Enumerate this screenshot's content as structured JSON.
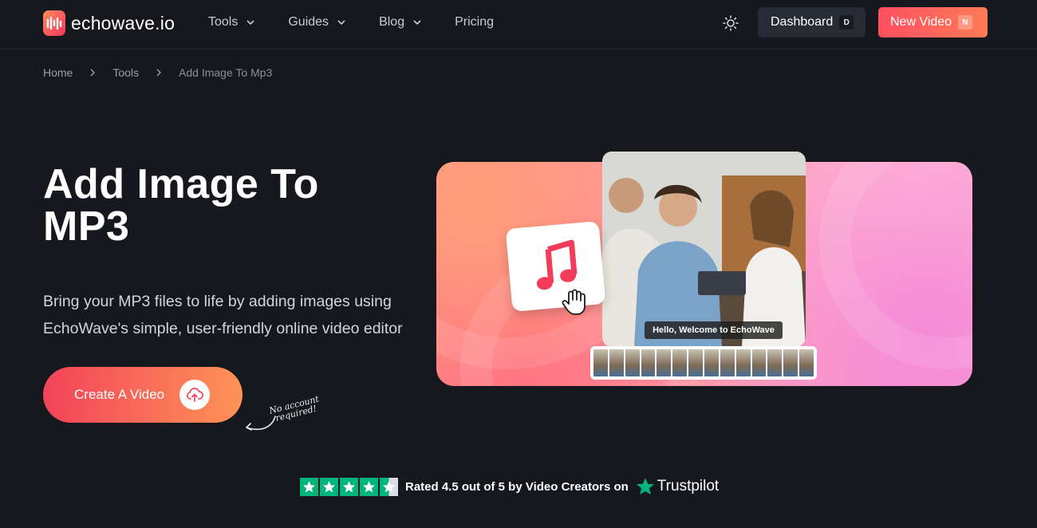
{
  "header": {
    "logo_text": "echowave.io",
    "nav": [
      {
        "label": "Tools",
        "has_dropdown": true
      },
      {
        "label": "Guides",
        "has_dropdown": true
      },
      {
        "label": "Blog",
        "has_dropdown": true
      },
      {
        "label": "Pricing",
        "has_dropdown": false
      }
    ],
    "theme_icon": "sun-icon",
    "dashboard": {
      "label": "Dashboard",
      "shortcut": "D"
    },
    "new_video": {
      "label": "New Video",
      "shortcut": "N"
    }
  },
  "breadcrumb": {
    "items": [
      "Home",
      "Tools",
      "Add Image To Mp3"
    ]
  },
  "hero": {
    "title_line1": "Add Image To",
    "title_line2": "MP3",
    "desc_line1": "Bring your MP3 files to life by adding images using",
    "desc_line2": "EchoWave's simple, user-friendly online video editor",
    "cta_label": "Create A Video",
    "note_line1": "No account",
    "note_line2": "required!"
  },
  "banner": {
    "caption": "Hello, Welcome to EchoWave"
  },
  "trust": {
    "text": "Rated 4.5 out of 5 by Video Creators on",
    "brand": "Trustpilot",
    "rating": 4.5,
    "max_rating": 5
  },
  "colors": {
    "background": "#16181d",
    "accent_start": "#f2435a",
    "accent_end": "#ff9356",
    "trustpilot_green": "#00b67a"
  }
}
